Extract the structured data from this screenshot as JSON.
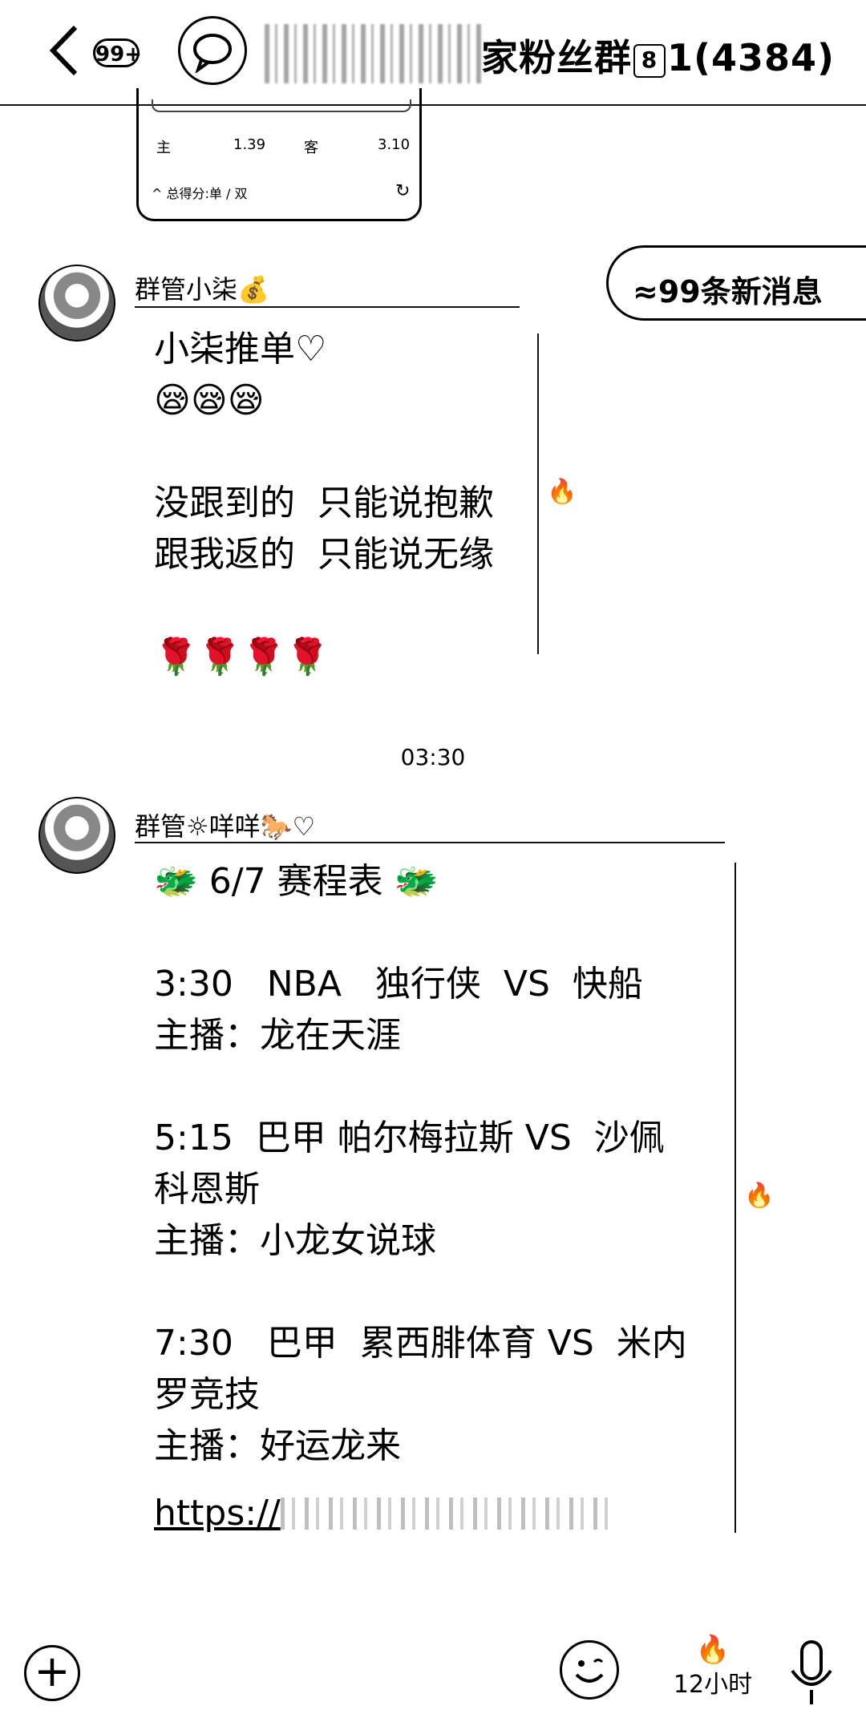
{
  "header": {
    "unread_badge": "99+",
    "title_visible": "家粉丝群",
    "title_badge": "8",
    "title_suffix": "1(4384)"
  },
  "odds_card": {
    "home_label": "主",
    "home_odds": "1.39",
    "away_label": "客",
    "away_odds": "3.10",
    "expand_label": "^ 总得分:单 / 双"
  },
  "new_messages": "≈99条新消息",
  "messages": [
    {
      "sender": "群管小柒💰",
      "text": "小柒推单♡\n😪😪😪\n\n没跟到的  只能说抱歉\n跟我返的  只能说无缘\n\n🌹🌹🌹🌹"
    },
    {
      "time": "03:30",
      "sender": "群管☼咩咩🐎♡",
      "text": "🐲 6/7 赛程表 🐲\n\n3:30   NBA   独行侠  VS  快船\n主播：龙在天涯\n\n5:15  巴甲 帕尔梅拉斯 VS  沙佩\n科恩斯\n主播：小龙女说球\n\n7:30   巴甲  累西腓体育 VS  米内\n罗竞技\n主播：好运龙来",
      "url_prefix": "https://"
    }
  ],
  "bottom_bar": {
    "burn_label": "12小时"
  },
  "icons": [
    "back-icon",
    "chat-bubbles-icon",
    "plus-icon",
    "emoji-icon",
    "fire-icon",
    "mic-icon",
    "refresh-icon"
  ]
}
